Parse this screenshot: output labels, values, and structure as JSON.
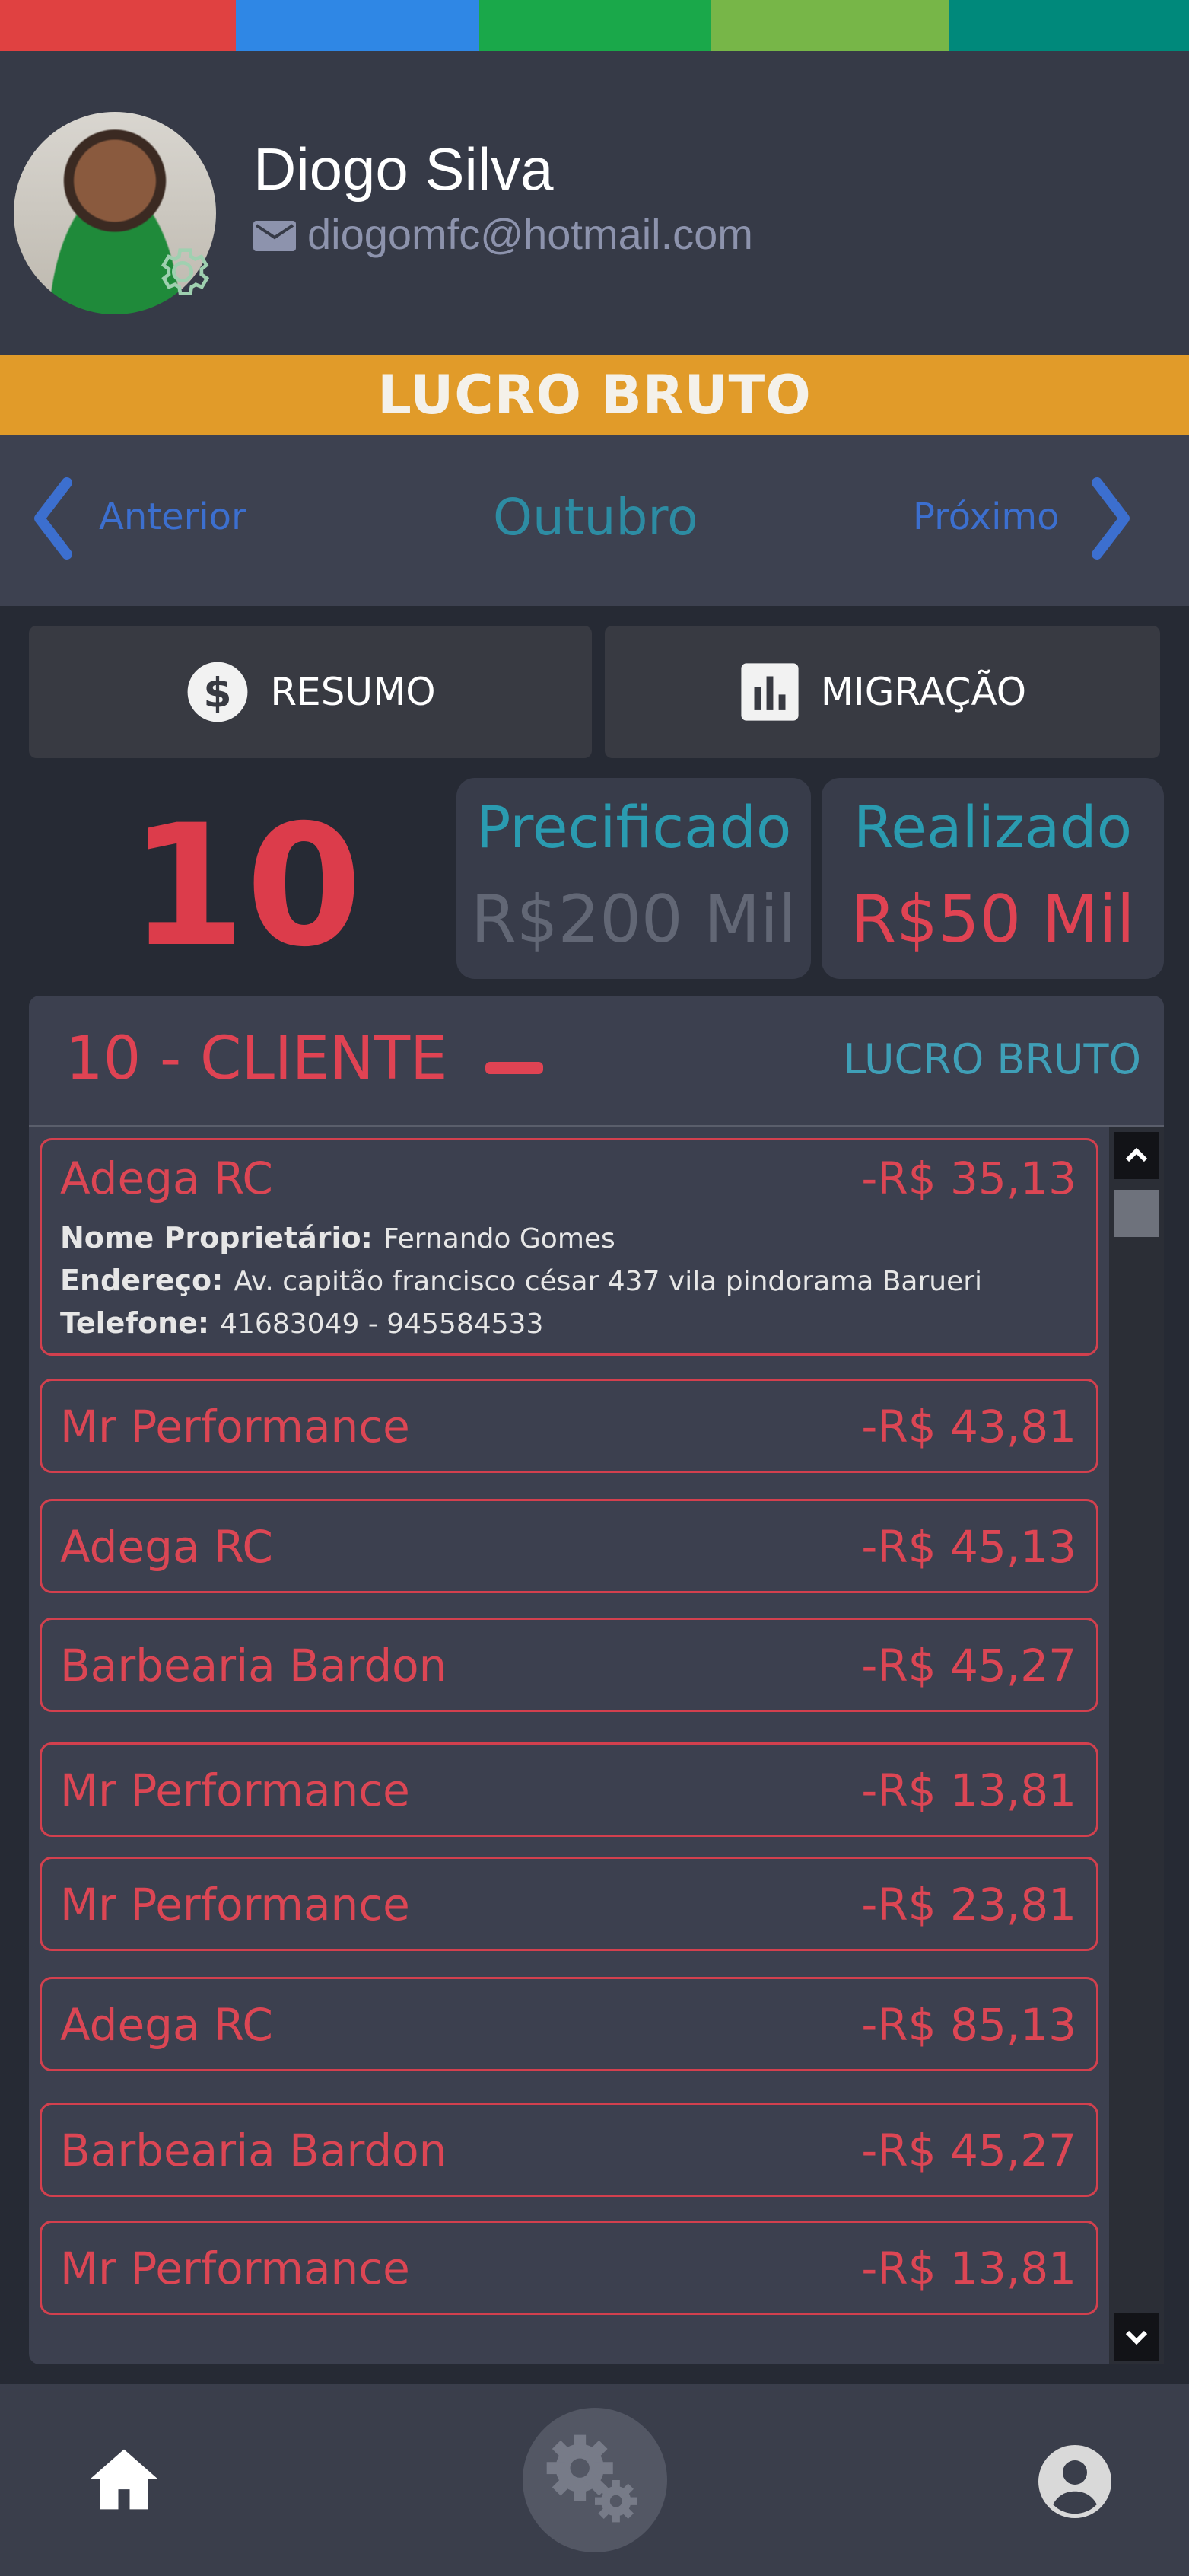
{
  "header": {
    "stripe_colors": [
      "#e04141",
      "#2f87e5",
      "#1aa84a",
      "#77b648",
      "#00897b"
    ],
    "user_name": "Diogo Silva",
    "user_email": "diogomfc@hotmail.com",
    "avatar_icon": "settings-gear-icon",
    "email_icon": "mail-icon"
  },
  "banner": {
    "title": "LUCRO BRUTO",
    "color": "#e19b29"
  },
  "month_nav": {
    "previous_label": "Anterior",
    "current_month": "Outubro",
    "next_label": "Próximo"
  },
  "tabs": [
    {
      "label": "RESUMO",
      "icon": "dollar-circle-icon"
    },
    {
      "label": "MIGRAÇÃO",
      "icon": "bar-chart-icon"
    }
  ],
  "summary": {
    "count": "10",
    "priced_title": "Precificado",
    "priced_value": "R$200 Mil",
    "done_title": "Realizado",
    "done_value": "R$50 Mil"
  },
  "clients": {
    "title": "10 - CLIENTE",
    "metric_label": "LUCRO BRUTO",
    "expanded": {
      "name": "Adega RC",
      "value": "-R$ 35,13",
      "owner_label": "Nome Proprietário:",
      "owner": "Fernando Gomes",
      "address_label": "Endereço:",
      "address": "Av. capitão francisco césar 437 vila pindorama Barueri",
      "phone_label": "Telefone:",
      "phone": "41683049 -  945584533"
    },
    "items": [
      {
        "name": "Mr Performance",
        "value": "-R$ 43,81"
      },
      {
        "name": "Adega RC",
        "value": "-R$ 45,13"
      },
      {
        "name": "Barbearia Bardon",
        "value": "-R$ 45,27"
      },
      {
        "name": "Mr Performance",
        "value": "-R$ 13,81"
      },
      {
        "name": "Mr Performance",
        "value": "-R$ 23,81"
      },
      {
        "name": "Adega RC",
        "value": "-R$ 85,13"
      },
      {
        "name": "Barbearia Bardon",
        "value": "-R$ 45,27"
      },
      {
        "name": "Mr Performance",
        "value": "-R$ 13,81"
      }
    ]
  },
  "bottom_nav": [
    {
      "icon": "home-icon"
    },
    {
      "icon": "settings-gears-icon"
    },
    {
      "icon": "account-icon"
    }
  ]
}
